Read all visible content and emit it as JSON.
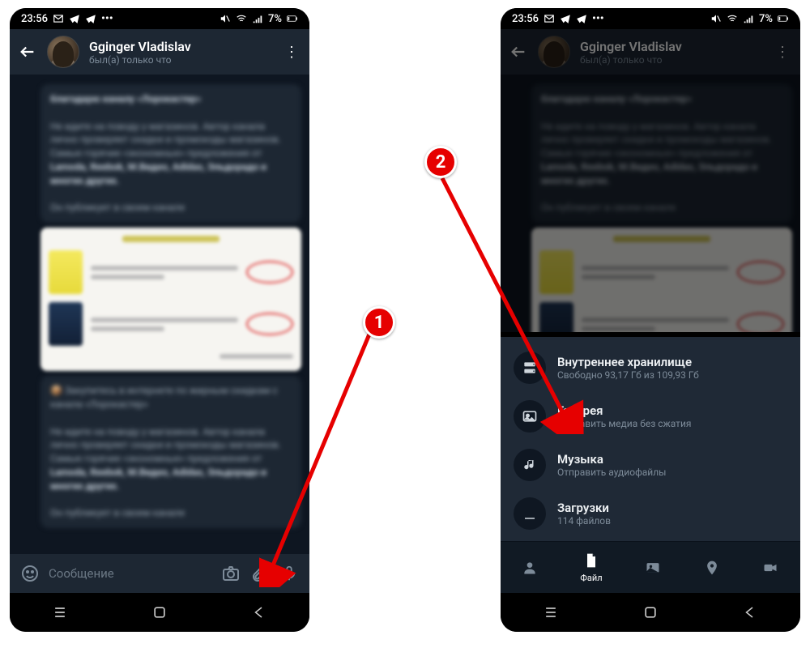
{
  "status": {
    "time": "23:56",
    "battery": "7%"
  },
  "chat": {
    "name": "Gginger Vladislav",
    "status_text": "был(а) только что"
  },
  "input": {
    "placeholder": "Сообщение"
  },
  "sheet": {
    "sources": [
      {
        "icon": "storage-icon",
        "title": "Внутреннее хранилище",
        "sub": "Свободно 93,17 Гб из 109,93 Гб"
      },
      {
        "icon": "gallery-icon",
        "title": "Галерея",
        "sub": "Отправить медиа без сжатия"
      },
      {
        "icon": "music-icon",
        "title": "Музыка",
        "sub": "Отправить аудиофайлы"
      },
      {
        "icon": "downloads-icon",
        "title": "Загрузки",
        "sub": "114 файлов"
      }
    ],
    "tabs": {
      "file_label": "Файл"
    }
  },
  "markers": {
    "one": "1",
    "two": "2"
  },
  "blur": {
    "h1": "благодарю каналу «",
    "h2": "»",
    "p1": "Не идите на поводу у магазинов. Автор канала лично проверяет скидки и промокоды магазинов. Самые горячие «экономные» предложения от ",
    "p2b": "Lamoda, Reebok, М.Видео, Adidas, Эльдорадо и многих других.",
    "p3": "Он публикует в своем канале",
    "q1": "Закупитесь в интернете по жирным скидкам с канала «",
    "q2": "»"
  }
}
